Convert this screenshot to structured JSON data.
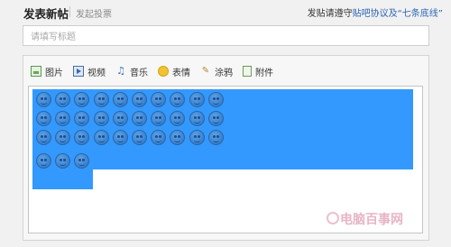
{
  "header": {
    "title": "发表新帖",
    "vote_link": "发起投票",
    "rules_prefix": "发贴请遵守",
    "rules_link": "贴吧协议及“七条底线”"
  },
  "title_input": {
    "placeholder": "请填写标题",
    "value": ""
  },
  "toolbar": {
    "items": [
      {
        "label": "图片",
        "icon": "image-icon"
      },
      {
        "label": "视频",
        "icon": "video-icon"
      },
      {
        "label": "音乐",
        "icon": "music-icon"
      },
      {
        "label": "表情",
        "icon": "emoji-icon"
      },
      {
        "label": "涂鸦",
        "icon": "graffiti-icon"
      },
      {
        "label": "附件",
        "icon": "attachment-icon"
      }
    ]
  },
  "editor": {
    "emoji_rows": [
      10,
      10,
      10,
      3
    ],
    "selection_color": "#3399ff"
  },
  "watermark": {
    "text": "电脑百事网"
  },
  "colors": {
    "link": "#2d64b3",
    "background": "#f1f1f1"
  }
}
